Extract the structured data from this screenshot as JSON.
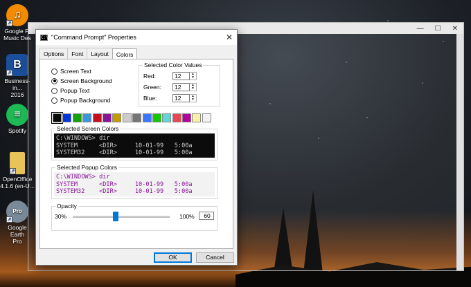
{
  "desktop": {
    "icons": [
      {
        "label_lines": [
          "Google Pl",
          "Music Des"
        ],
        "glyph": "♫",
        "color": "#f28b00"
      },
      {
        "label_lines": [
          "Business-in...",
          "2016"
        ],
        "glyph": "B",
        "color": "#1b4f9c"
      },
      {
        "label_lines": [
          "Spotify"
        ],
        "glyph": "≡",
        "color": "#1db954"
      },
      {
        "label_lines": [
          "OpenOffice",
          "4.1.6 (en-U..."
        ],
        "glyph": "",
        "color": "#e8c35a"
      },
      {
        "label_lines": [
          "Google Earth",
          "Pro"
        ],
        "glyph": "Pro",
        "color": "#7a8a99"
      }
    ]
  },
  "dialog": {
    "title": "\"Command Prompt\" Properties",
    "close_glyph": "✕",
    "tabs": [
      {
        "label": "Options",
        "active": false
      },
      {
        "label": "Font",
        "active": false
      },
      {
        "label": "Layout",
        "active": false
      },
      {
        "label": "Colors",
        "active": true
      }
    ],
    "color_targets": [
      {
        "label": "Screen Text",
        "selected": false
      },
      {
        "label": "Screen Background",
        "selected": true
      },
      {
        "label": "Popup Text",
        "selected": false
      },
      {
        "label": "Popup Background",
        "selected": false
      }
    ],
    "selected_color_values": {
      "legend": "Selected Color Values",
      "red_label": "Red:",
      "red": "12",
      "green_label": "Green:",
      "green": "12",
      "blue_label": "Blue:",
      "blue": "12",
      "up_glyph": "▲",
      "down_glyph": "▼"
    },
    "palette": [
      "#0c0c0c",
      "#0037da",
      "#13a10e",
      "#3a96dd",
      "#c50f1f",
      "#881798",
      "#c19c00",
      "#cccccc",
      "#767676",
      "#3b78ff",
      "#16c60c",
      "#61d6d6",
      "#e74856",
      "#b4009e",
      "#f9f1a5",
      "#f2f2f2"
    ],
    "palette_selected_index": 0,
    "screen_preview": {
      "legend": "Selected Screen Colors",
      "lines": [
        "C:\\WINDOWS> dir",
        "SYSTEM      <DIR>     10-01-99   5:00a",
        "SYSTEM32    <DIR>     10-01-99   5:00a"
      ]
    },
    "popup_preview": {
      "legend": "Selected Popup Colors",
      "lines": [
        "C:\\WINDOWS> dir",
        "SYSTEM      <DIR>     10-01-99   5:00a",
        "SYSTEM32    <DIR>     10-01-99   5:00a"
      ]
    },
    "opacity": {
      "legend": "Opacity",
      "min_label": "30%",
      "max_label": "100%",
      "value": "60"
    },
    "ok_label": "OK",
    "cancel_label": "Cancel"
  }
}
